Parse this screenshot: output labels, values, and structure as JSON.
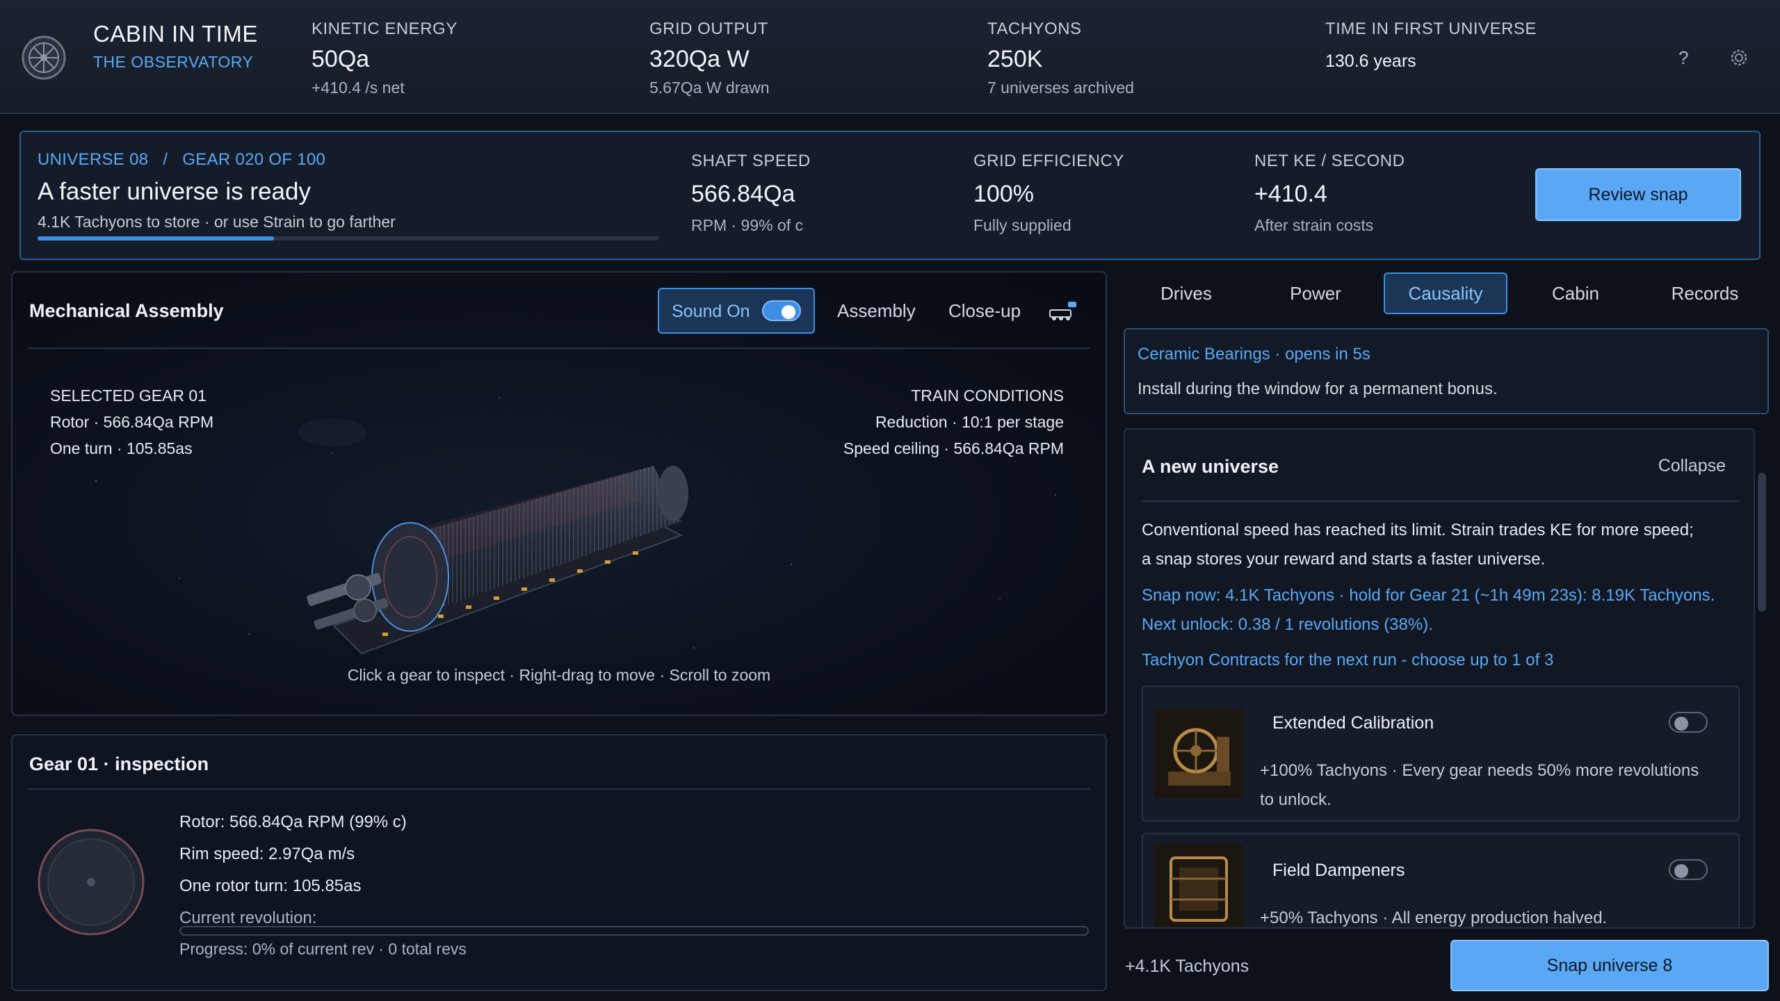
{
  "header": {
    "title": "CABIN IN TIME",
    "subtitle": "THE OBSERVATORY",
    "stats": [
      {
        "label": "KINETIC ENERGY",
        "value": "50Qa",
        "sub": "+410.4 /s net"
      },
      {
        "label": "GRID OUTPUT",
        "value": "320Qa W",
        "sub": "5.67Qa W drawn"
      },
      {
        "label": "TACHYONS",
        "value": "250K",
        "sub": "7 universes archived"
      },
      {
        "label": "TIME IN FIRST UNIVERSE",
        "value": "130.6 years",
        "sub": ""
      }
    ],
    "help_glyph": "?",
    "icons": {
      "logo": "wheel-icon",
      "help": "help-icon",
      "settings": "gear-icon"
    }
  },
  "banner": {
    "universe": "UNIVERSE 08",
    "separator": "/",
    "gear": "GEAR 020 OF 100",
    "heading": "A faster universe is ready",
    "description": "4.1K Tachyons to store · or use Strain to go farther",
    "progress_percent": 38,
    "stats": [
      {
        "label": "SHAFT SPEED",
        "value": "566.84Qa",
        "sub": "RPM · 99% of c"
      },
      {
        "label": "GRID EFFICIENCY",
        "value": "100%",
        "sub": "Fully supplied"
      },
      {
        "label": "NET KE / SECOND",
        "value": "+410.4",
        "sub": "After strain costs"
      }
    ],
    "review_button": "Review snap"
  },
  "assembly": {
    "title": "Mechanical Assembly",
    "sound_label": "Sound On",
    "sound_on": true,
    "tabs": [
      "Assembly",
      "Close-up"
    ],
    "selected": {
      "title": "SELECTED GEAR 01",
      "rotor": "Rotor · 566.84Qa RPM",
      "turn": "One turn · 105.85as"
    },
    "conditions": {
      "title": "TRAIN CONDITIONS",
      "reduction": "Reduction · 10:1 per stage",
      "ceiling": "Speed ceiling · 566.84Qa RPM"
    },
    "hint": "Click a gear to inspect · Right-drag to move · Scroll to zoom"
  },
  "inspection": {
    "title": "Gear 01 · inspection",
    "rotor": "Rotor: 566.84Qa RPM (99% c)",
    "rim": "Rim speed: 2.97Qa m/s",
    "turn": "One rotor turn: 105.85as",
    "current_label": "Current revolution:",
    "progress_percent": 0,
    "progress_text": "Progress: 0% of current rev · 0 total revs"
  },
  "side_tabs": [
    {
      "label": "Drives",
      "active": false
    },
    {
      "label": "Power",
      "active": false
    },
    {
      "label": "Causality",
      "active": true
    },
    {
      "label": "Cabin",
      "active": false
    },
    {
      "label": "Records",
      "active": false
    }
  ],
  "notice": {
    "title": "Ceramic Bearings · opens in 5s",
    "text": "Install during the window for a permanent bonus."
  },
  "new_universe": {
    "title": "A new universe",
    "collapse": "Collapse",
    "description_1": "Conventional speed has reached its limit. Strain trades KE for more speed;",
    "description_2": "a snap stores your reward and starts a faster universe.",
    "snap_line_1": "Snap now: 4.1K Tachyons · hold for Gear 21 (~1h 49m 23s): 8.19K Tachyons.",
    "snap_line_2": "Next unlock: 0.38 / 1 revolutions (38%).",
    "contracts_title": "Tachyon Contracts for the next run - choose up to 1 of 3",
    "contracts": [
      {
        "name": "Extended Calibration",
        "desc_1": "+100% Tachyons · Every gear needs 50% more revolutions",
        "desc_2": "to unlock.",
        "enabled": false
      },
      {
        "name": "Field Dampeners",
        "desc_1": "+50% Tachyons · All energy production halved.",
        "desc_2": "",
        "enabled": false
      }
    ]
  },
  "footer": {
    "reward": "+4.1K Tachyons",
    "snap_button": "Snap universe 8"
  },
  "colors": {
    "accent": "#5aa8f5",
    "background": "#0c111a",
    "panel_border": "#283242"
  }
}
